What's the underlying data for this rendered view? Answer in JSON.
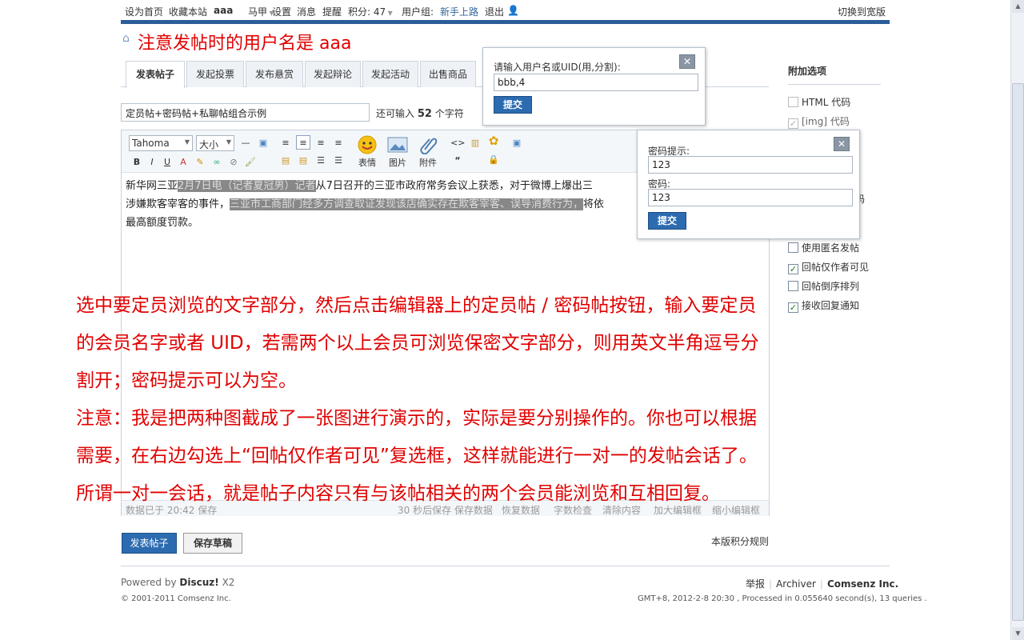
{
  "topbar": {
    "set_home": "设为首页",
    "bookmark": "收藏本站",
    "username": "aaa",
    "majia": "马甲",
    "settings": "设置",
    "messages": "消息",
    "reminders": "提醒",
    "points": "积分: 47",
    "usergroup_label": "用户组:",
    "usergroup": "新手上路",
    "logout": "退出",
    "switch_wide": "切换到宽版"
  },
  "notice": "注意发帖时的用户名是 aaa",
  "tabs": [
    "发表帖子",
    "发起投票",
    "发布悬赏",
    "发起辩论",
    "发起活动",
    "出售商品"
  ],
  "subject": {
    "value": "定员帖+密码帖+私聊帖组合示例",
    "hint_prefix": "还可输入",
    "hint_count": "52",
    "hint_suffix": "个字符"
  },
  "toolbar": {
    "font": "Tahoma",
    "size": "大小",
    "emoticon": "表情",
    "image": "图片",
    "attachment": "附件"
  },
  "content": {
    "p1_a": "新华网三亚",
    "p1_hl": "2月7日电（记者夏冠男）记者",
    "p1_b": "从7日召开的三亚市政府常务会议上获悉，对于微博上爆出三",
    "p2_a": "涉嫌欺客宰客的事件，",
    "p2_hl": "三亚市工商部门经多方调查取证发现该店确实存在欺客宰客、误导消费行为，",
    "p2_b": "将依",
    "p3": "最高额度罚款。"
  },
  "statusbar": {
    "saved": "数据已于 20:42 保存",
    "autosave": "30 秒后保存 保存数据",
    "restore": "恢复数据",
    "wordcount": "字数检查",
    "clear": "清除内容",
    "enlarge": "加大编辑框",
    "shrink": "缩小编辑框"
  },
  "sidebar": {
    "title": "附加选项",
    "opt_html": "HTML 代码",
    "opt_img": "[img] 代码",
    "opt_code_tail": "码",
    "opt_anon": "使用匿名发帖",
    "opt_author_only": "回帖仅作者可见",
    "opt_reverse": "回帖倒序排列",
    "opt_notify": "接收回复通知"
  },
  "popup_uid": {
    "label": "请输入用户名或UID(用,分割):",
    "value": "bbb,4",
    "submit": "提交"
  },
  "popup_password": {
    "hint_label": "密码提示:",
    "hint_value": "123",
    "pwd_label": "密码:",
    "pwd_value": "123",
    "submit": "提交"
  },
  "annotation": {
    "line1": "选中要定员浏览的文字部分，然后点击编辑器上的定员帖 / 密码帖按钮，输入要定员",
    "line2": "的会员名字或者 UID，若需两个以上会员可浏览保密文字部分，则用英文半角逗号分",
    "line3": "割开；密码提示可以为空。",
    "line4": "注意：我是把两种图截成了一张图进行演示的，实际是要分别操作的。你也可以根据",
    "line5": "需要，在右边勾选上“回帖仅作者可见”复选框，这样就能进行一对一的发帖会话了。",
    "line6": "所谓一对一会话，就是帖子内容只有与该帖相关的两个会员能浏览和互相回复。"
  },
  "footer": {
    "post_button": "发表帖子",
    "draft_button": "保存草稿",
    "rules": "本版积分规则",
    "powered_prefix": "Powered by",
    "powered_brand": "Discuz!",
    "powered_version": "X2",
    "copyright": "© 2001-2011 Comsenz Inc.",
    "report": "举报",
    "archiver": "Archiver",
    "company": "Comsenz Inc.",
    "gmt": "GMT+8, 2012-2-8 20:30 , Processed in 0.055640 second(s), 13 queries ."
  },
  "colors": {
    "accent_blue": "#2c6bb0",
    "annotation_red": "#e00000"
  }
}
